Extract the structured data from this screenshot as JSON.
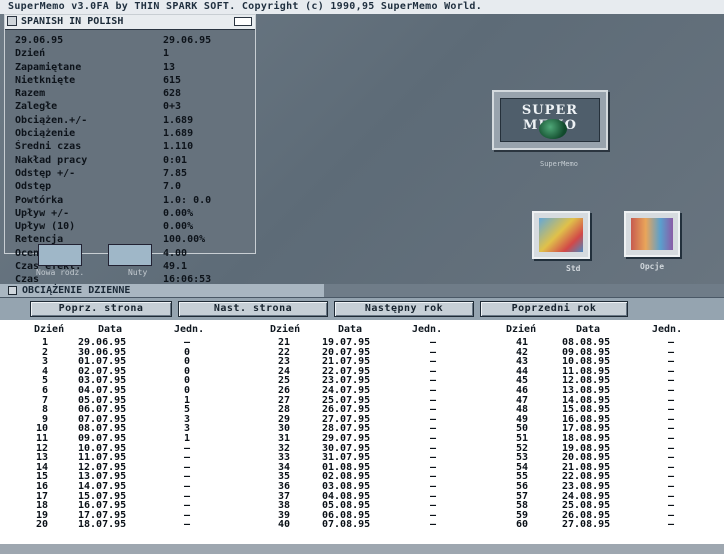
{
  "title_bar": "SuperMemo v3.0FA by THIN SPARK SOFT. Copyright (c) 1990,95 SuperMemo World.",
  "stats": {
    "title": "SPANISH IN POLISH",
    "rows": [
      {
        "k": "29.06.95",
        "v": "29.06.95"
      },
      {
        "k": "Dzień",
        "v": "1"
      },
      {
        "k": "Zapamiętane",
        "v": "13"
      },
      {
        "k": "Nietknięte",
        "v": "615"
      },
      {
        "k": "Razem",
        "v": "628"
      },
      {
        "k": "Zaległe",
        "v": "0+3"
      },
      {
        "k": "Obciążen.+/-",
        "v": "1.689"
      },
      {
        "k": "Obciążenie",
        "v": "1.689"
      },
      {
        "k": "Średni czas",
        "v": "1.110"
      },
      {
        "k": "Nakład pracy",
        "v": "0:01"
      },
      {
        "k": "Odstęp +/-",
        "v": "7.85"
      },
      {
        "k": "Odstęp",
        "v": "7.0"
      },
      {
        "k": "Powtórka",
        "v": "1.0: 0.0"
      },
      {
        "k": "Upływ +/-",
        "v": "0.00%"
      },
      {
        "k": "Upływ (10)",
        "v": "0.00%"
      },
      {
        "k": "Retencja",
        "v": "100.00%"
      },
      {
        "k": "Ocena",
        "v": "4.00"
      },
      {
        "k": "Czas efekt.",
        "v": "49.1"
      },
      {
        "k": "Czas",
        "v": "16:06:53"
      }
    ]
  },
  "workbench_icons": {
    "left1_label": "Nowa rodz.",
    "left2_label": "Nuty",
    "logo_text": "SUPER MEMO",
    "logo_caption": "SuperMemo",
    "std_label": "Std",
    "opcje_label": "Opcje"
  },
  "load_window": {
    "title": "OBCIĄŻENIE DZIENNE",
    "buttons": [
      "Poprz. strona",
      "Nast. strona",
      "Następny rok",
      "Poprzedni rok"
    ],
    "headers": {
      "day": "Dzień",
      "date": "Data",
      "units": "Jedn."
    },
    "columns": [
      [
        [
          "1",
          "29.06.95",
          "—"
        ],
        [
          "2",
          "30.06.95",
          "0"
        ],
        [
          "3",
          "01.07.95",
          "0"
        ],
        [
          "4",
          "02.07.95",
          "0"
        ],
        [
          "5",
          "03.07.95",
          "0"
        ],
        [
          "6",
          "04.07.95",
          "0"
        ],
        [
          "7",
          "05.07.95",
          "1"
        ],
        [
          "8",
          "06.07.95",
          "5"
        ],
        [
          "9",
          "07.07.95",
          "3"
        ],
        [
          "10",
          "08.07.95",
          "3"
        ],
        [
          "11",
          "09.07.95",
          "1"
        ],
        [
          "12",
          "10.07.95",
          "—"
        ],
        [
          "13",
          "11.07.95",
          "—"
        ],
        [
          "14",
          "12.07.95",
          "—"
        ],
        [
          "15",
          "13.07.95",
          "—"
        ],
        [
          "16",
          "14.07.95",
          "—"
        ],
        [
          "17",
          "15.07.95",
          "—"
        ],
        [
          "18",
          "16.07.95",
          "—"
        ],
        [
          "19",
          "17.07.95",
          "—"
        ],
        [
          "20",
          "18.07.95",
          "—"
        ]
      ],
      [
        [
          "21",
          "19.07.95",
          "—"
        ],
        [
          "22",
          "20.07.95",
          "—"
        ],
        [
          "23",
          "21.07.95",
          "—"
        ],
        [
          "24",
          "22.07.95",
          "—"
        ],
        [
          "25",
          "23.07.95",
          "—"
        ],
        [
          "26",
          "24.07.95",
          "—"
        ],
        [
          "27",
          "25.07.95",
          "—"
        ],
        [
          "28",
          "26.07.95",
          "—"
        ],
        [
          "29",
          "27.07.95",
          "—"
        ],
        [
          "30",
          "28.07.95",
          "—"
        ],
        [
          "31",
          "29.07.95",
          "—"
        ],
        [
          "32",
          "30.07.95",
          "—"
        ],
        [
          "33",
          "31.07.95",
          "—"
        ],
        [
          "34",
          "01.08.95",
          "—"
        ],
        [
          "35",
          "02.08.95",
          "—"
        ],
        [
          "36",
          "03.08.95",
          "—"
        ],
        [
          "37",
          "04.08.95",
          "—"
        ],
        [
          "38",
          "05.08.95",
          "—"
        ],
        [
          "39",
          "06.08.95",
          "—"
        ],
        [
          "40",
          "07.08.95",
          "—"
        ]
      ],
      [
        [
          "41",
          "08.08.95",
          "—"
        ],
        [
          "42",
          "09.08.95",
          "—"
        ],
        [
          "43",
          "10.08.95",
          "—"
        ],
        [
          "44",
          "11.08.95",
          "—"
        ],
        [
          "45",
          "12.08.95",
          "—"
        ],
        [
          "46",
          "13.08.95",
          "—"
        ],
        [
          "47",
          "14.08.95",
          "—"
        ],
        [
          "48",
          "15.08.95",
          "—"
        ],
        [
          "49",
          "16.08.95",
          "—"
        ],
        [
          "50",
          "17.08.95",
          "—"
        ],
        [
          "51",
          "18.08.95",
          "—"
        ],
        [
          "52",
          "19.08.95",
          "—"
        ],
        [
          "53",
          "20.08.95",
          "—"
        ],
        [
          "54",
          "21.08.95",
          "—"
        ],
        [
          "55",
          "22.08.95",
          "—"
        ],
        [
          "56",
          "23.08.95",
          "—"
        ],
        [
          "57",
          "24.08.95",
          "—"
        ],
        [
          "58",
          "25.08.95",
          "—"
        ],
        [
          "59",
          "26.08.95",
          "—"
        ],
        [
          "60",
          "27.08.95",
          "—"
        ]
      ]
    ]
  }
}
